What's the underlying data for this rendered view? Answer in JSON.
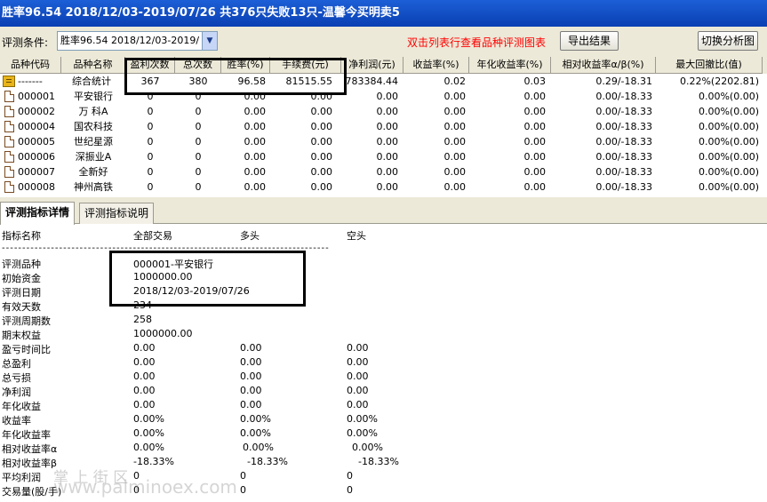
{
  "window": {
    "title": "胜率96.54  2018/12/03-2019/07/26 共376只失败13只-温馨今买明卖5"
  },
  "toolbar": {
    "condition_label": "评测条件:",
    "condition_value": "胜率96.54  2018/12/03-2019/",
    "hint": "双击列表行查看品种评测图表",
    "export_label": "导出结果",
    "switch_label": "切换分析图"
  },
  "grid": {
    "columns": [
      "品种代码",
      "品种名称",
      "盈利次数",
      "总次数",
      "胜率(%)",
      "手续费(元)",
      "净利润(元)",
      "收益率(%)",
      "年化收益率(%)",
      "相对收益率α/β(%)",
      "最大回撤比(值)"
    ],
    "rows": [
      {
        "code": "-------",
        "name": "综合统计",
        "wins": "367",
        "total": "380",
        "winrate": "96.58",
        "fee": "81515.55",
        "profit": "783384.44",
        "ret": "0.02",
        "annual": "0.03",
        "relative": "0.29/-18.31",
        "drawdown": "0.22%(2202.81)"
      },
      {
        "code": "000001",
        "name": "平安银行",
        "wins": "0",
        "total": "0",
        "winrate": "0.00",
        "fee": "0.00",
        "profit": "0.00",
        "ret": "0.00",
        "annual": "0.00",
        "relative": "0.00/-18.33",
        "drawdown": "0.00%(0.00)"
      },
      {
        "code": "000002",
        "name": "万 科A",
        "wins": "0",
        "total": "0",
        "winrate": "0.00",
        "fee": "0.00",
        "profit": "0.00",
        "ret": "0.00",
        "annual": "0.00",
        "relative": "0.00/-18.33",
        "drawdown": "0.00%(0.00)"
      },
      {
        "code": "000004",
        "name": "国农科技",
        "wins": "0",
        "total": "0",
        "winrate": "0.00",
        "fee": "0.00",
        "profit": "0.00",
        "ret": "0.00",
        "annual": "0.00",
        "relative": "0.00/-18.33",
        "drawdown": "0.00%(0.00)"
      },
      {
        "code": "000005",
        "name": "世纪星源",
        "wins": "0",
        "total": "0",
        "winrate": "0.00",
        "fee": "0.00",
        "profit": "0.00",
        "ret": "0.00",
        "annual": "0.00",
        "relative": "0.00/-18.33",
        "drawdown": "0.00%(0.00)"
      },
      {
        "code": "000006",
        "name": "深振业A",
        "wins": "0",
        "total": "0",
        "winrate": "0.00",
        "fee": "0.00",
        "profit": "0.00",
        "ret": "0.00",
        "annual": "0.00",
        "relative": "0.00/-18.33",
        "drawdown": "0.00%(0.00)"
      },
      {
        "code": "000007",
        "name": "全新好",
        "wins": "0",
        "total": "0",
        "winrate": "0.00",
        "fee": "0.00",
        "profit": "0.00",
        "ret": "0.00",
        "annual": "0.00",
        "relative": "0.00/-18.33",
        "drawdown": "0.00%(0.00)"
      },
      {
        "code": "000008",
        "name": "神州高铁",
        "wins": "0",
        "total": "0",
        "winrate": "0.00",
        "fee": "0.00",
        "profit": "0.00",
        "ret": "0.00",
        "annual": "0.00",
        "relative": "0.00/-18.33",
        "drawdown": "0.00%(0.00)"
      }
    ]
  },
  "tabs": [
    {
      "label": "评测指标详情",
      "active": true
    },
    {
      "label": "评测指标说明",
      "active": false
    }
  ],
  "detail": {
    "headers": {
      "name": "指标名称",
      "all": "全部交易",
      "long": "多头",
      "short": "空头"
    },
    "separator": "--------------------------------------------------------------------------------",
    "items": [
      {
        "label": "评测品种",
        "all": "000001-平安银行",
        "long": "",
        "short": ""
      },
      {
        "label": "初始资金",
        "all": "1000000.00",
        "long": "",
        "short": ""
      },
      {
        "label": "评测日期",
        "all": "2018/12/03-2019/07/26",
        "long": "",
        "short": ""
      },
      {
        "label": "有效天数",
        "all": "234",
        "long": "",
        "short": ""
      },
      {
        "label": "评测周期数",
        "all": "258",
        "long": "",
        "short": ""
      },
      {
        "label": "期末权益",
        "all": "1000000.00",
        "long": "",
        "short": ""
      },
      {
        "label": "盈亏时间比",
        "all": "0.00",
        "long": "0.00",
        "short": "0.00"
      },
      {
        "label": "总盈利",
        "all": "0.00",
        "long": "0.00",
        "short": "0.00"
      },
      {
        "label": "总亏损",
        "all": "0.00",
        "long": "0.00",
        "short": "0.00"
      },
      {
        "label": "净利润",
        "all": "0.00",
        "long": "0.00",
        "short": "0.00"
      },
      {
        "label": "年化收益",
        "all": "0.00",
        "long": "0.00",
        "short": "0.00"
      },
      {
        "label": "收益率",
        "all": "0.00%",
        "long": "0.00%",
        "short": "0.00%"
      },
      {
        "label": "年化收益率",
        "all": "0.00%",
        "long": "0.00%",
        "short": "0.00%"
      },
      {
        "label": "相对收益率α",
        "all": "0.00%",
        "long": "0.00%",
        "short": "0.00%"
      },
      {
        "label": "相对收益率β",
        "all": "-18.33%",
        "long": "-18.33%",
        "short": "-18.33%"
      },
      {
        "label": "平均利润",
        "all": "0",
        "long": "0",
        "short": "0"
      },
      {
        "label": "交易量(股/手)",
        "all": "0",
        "long": "0",
        "short": "0"
      }
    ]
  },
  "watermark": {
    "line1": "掌 上 街 区",
    "line2": "www.palminoex.com"
  }
}
